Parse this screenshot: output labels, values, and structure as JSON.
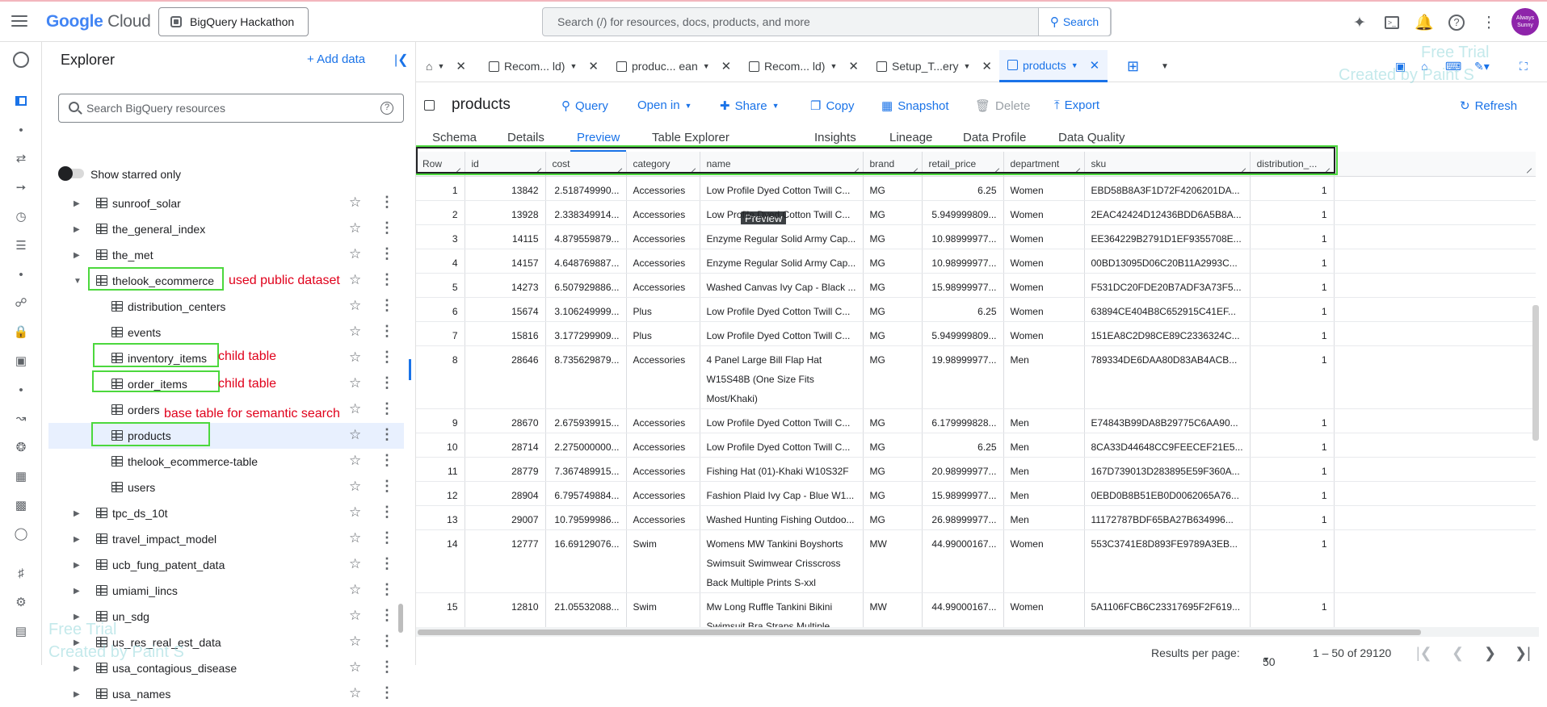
{
  "topbar": {
    "logo_google": "Google",
    "logo_cloud": "Cloud",
    "project": "BigQuery Hackathon",
    "search_placeholder": "Search (/) for resources, docs, products, and more",
    "search_button": "Search",
    "avatar_text": "Always Sunny"
  },
  "explorer": {
    "title": "Explorer",
    "add_data": "+ Add data",
    "search_placeholder": "Search BigQuery resources",
    "show_starred": "Show starred only",
    "nodes": [
      {
        "label": "sunroof_solar",
        "level": 0
      },
      {
        "label": "the_general_index",
        "level": 0
      },
      {
        "label": "the_met",
        "level": 0
      },
      {
        "label": "thelook_ecommerce",
        "level": 0,
        "expanded": true
      },
      {
        "label": "distribution_centers",
        "level": 1
      },
      {
        "label": "events",
        "level": 1
      },
      {
        "label": "inventory_items",
        "level": 1
      },
      {
        "label": "order_items",
        "level": 1
      },
      {
        "label": "orders",
        "level": 1
      },
      {
        "label": "products",
        "level": 1,
        "selected": true
      },
      {
        "label": "thelook_ecommerce-table",
        "level": 1
      },
      {
        "label": "users",
        "level": 1
      },
      {
        "label": "tpc_ds_10t",
        "level": 0
      },
      {
        "label": "travel_impact_model",
        "level": 0
      },
      {
        "label": "ucb_fung_patent_data",
        "level": 0
      },
      {
        "label": "umiami_lincs",
        "level": 0
      },
      {
        "label": "un_sdg",
        "level": 0
      },
      {
        "label": "us_res_real_est_data",
        "level": 0
      },
      {
        "label": "usa_contagious_disease",
        "level": 0
      },
      {
        "label": "usa_names",
        "level": 0
      }
    ],
    "annotations": {
      "public": "used public dataset",
      "child1": "child table",
      "child2": "child table",
      "base": "base table for semantic search"
    }
  },
  "watermarks": {
    "free_trial": "Free Trial",
    "created_by": "Created by Paint S"
  },
  "tabs": [
    {
      "label": "Recom... ld)"
    },
    {
      "label": "produc... ean"
    },
    {
      "label": "Recom... ld)"
    },
    {
      "label": "Setup_T...ery"
    },
    {
      "label": "products",
      "active": true
    }
  ],
  "toolbar": {
    "title": "products",
    "query": "Query",
    "open_in": "Open in",
    "share": "Share",
    "copy": "Copy",
    "snapshot": "Snapshot",
    "delete": "Delete",
    "export": "Export",
    "refresh": "Refresh"
  },
  "subtabs": [
    "Schema",
    "Details",
    "Preview",
    "Table Explorer",
    "Insights",
    "Lineage",
    "Data Profile",
    "Data Quality"
  ],
  "tooltip": "Preview",
  "table": {
    "columns": [
      "Row",
      "id",
      "cost",
      "category",
      "name",
      "brand",
      "retail_price",
      "department",
      "sku",
      "distribution_..."
    ],
    "rows": [
      [
        "1",
        "13842",
        "2.518749990...",
        "Accessories",
        "Low Profile Dyed Cotton Twill C...",
        "MG",
        "6.25",
        "Women",
        "EBD58B8A3F1D72F4206201DA...",
        "1"
      ],
      [
        "2",
        "13928",
        "2.338349914...",
        "Accessories",
        "Low Profile Dyed Cotton Twill C...",
        "MG",
        "5.949999809...",
        "Women",
        "2EAC42424D12436BDD6A5B8A...",
        "1"
      ],
      [
        "3",
        "14115",
        "4.879559879...",
        "Accessories",
        "Enzyme Regular Solid Army Cap...",
        "MG",
        "10.98999977...",
        "Women",
        "EE364229B2791D1EF9355708E...",
        "1"
      ],
      [
        "4",
        "14157",
        "4.648769887...",
        "Accessories",
        "Enzyme Regular Solid Army Cap...",
        "MG",
        "10.98999977...",
        "Women",
        "00BD13095D06C20B11A2993C...",
        "1"
      ],
      [
        "5",
        "14273",
        "6.507929886...",
        "Accessories",
        "Washed Canvas Ivy Cap - Black ...",
        "MG",
        "15.98999977...",
        "Women",
        "F531DC20FDE20B7ADF3A73F5...",
        "1"
      ],
      [
        "6",
        "15674",
        "3.106249999...",
        "Plus",
        "Low Profile Dyed Cotton Twill C...",
        "MG",
        "6.25",
        "Women",
        "63894CE404B8C652915C41EF...",
        "1"
      ],
      [
        "7",
        "15816",
        "3.177299909...",
        "Plus",
        "Low Profile Dyed Cotton Twill C...",
        "MG",
        "5.949999809...",
        "Women",
        "151EA8C2D98CE89C2336324C...",
        "1"
      ],
      [
        "8",
        "28646",
        "8.735629879...",
        "Accessories",
        "4 Panel Large Bill Flap Hat W15S48B (One Size Fits Most/Khaki)",
        "MG",
        "19.98999977...",
        "Men",
        "789334DE6DAA80D83AB4ACB...",
        "1"
      ],
      [
        "9",
        "28670",
        "2.675939915...",
        "Accessories",
        "Low Profile Dyed Cotton Twill C...",
        "MG",
        "6.179999828...",
        "Men",
        "E74843B99DA8B29775C6AA90...",
        "1"
      ],
      [
        "10",
        "28714",
        "2.275000000...",
        "Accessories",
        "Low Profile Dyed Cotton Twill C...",
        "MG",
        "6.25",
        "Men",
        "8CA33D44648CC9FEECEF21E5...",
        "1"
      ],
      [
        "11",
        "28779",
        "7.367489915...",
        "Accessories",
        "Fishing Hat (01)-Khaki W10S32F",
        "MG",
        "20.98999977...",
        "Men",
        "167D739013D283895E59F360A...",
        "1"
      ],
      [
        "12",
        "28904",
        "6.795749884...",
        "Accessories",
        "Fashion Plaid Ivy Cap - Blue W1...",
        "MG",
        "15.98999977...",
        "Men",
        "0EBD0B8B51EB0D0062065A76...",
        "1"
      ],
      [
        "13",
        "29007",
        "10.79599986...",
        "Accessories",
        "Washed Hunting Fishing Outdoo...",
        "MG",
        "26.98999977...",
        "Men",
        "11172787BDF65BA27B634996...",
        "1"
      ],
      [
        "14",
        "12777",
        "16.69129076...",
        "Swim",
        "Womens MW Tankini Boyshorts Swimsuit Swimwear Crisscross Back Multiple Prints S-xxl",
        "MW",
        "44.99000167...",
        "Women",
        "553C3741E8D893FE9789A3EB...",
        "1"
      ],
      [
        "15",
        "12810",
        "21.05532088...",
        "Swim",
        "Mw Long Ruffle Tankini Bikini Swimsuit Bra Straps Multiple Prints",
        "MW",
        "44.99000167...",
        "Women",
        "5A1106FCB6C23317695F2F619...",
        "1"
      ]
    ]
  },
  "footer": {
    "rpp_label": "Results per page:",
    "rpp_value": "50",
    "range": "1 – 50 of 29120"
  }
}
